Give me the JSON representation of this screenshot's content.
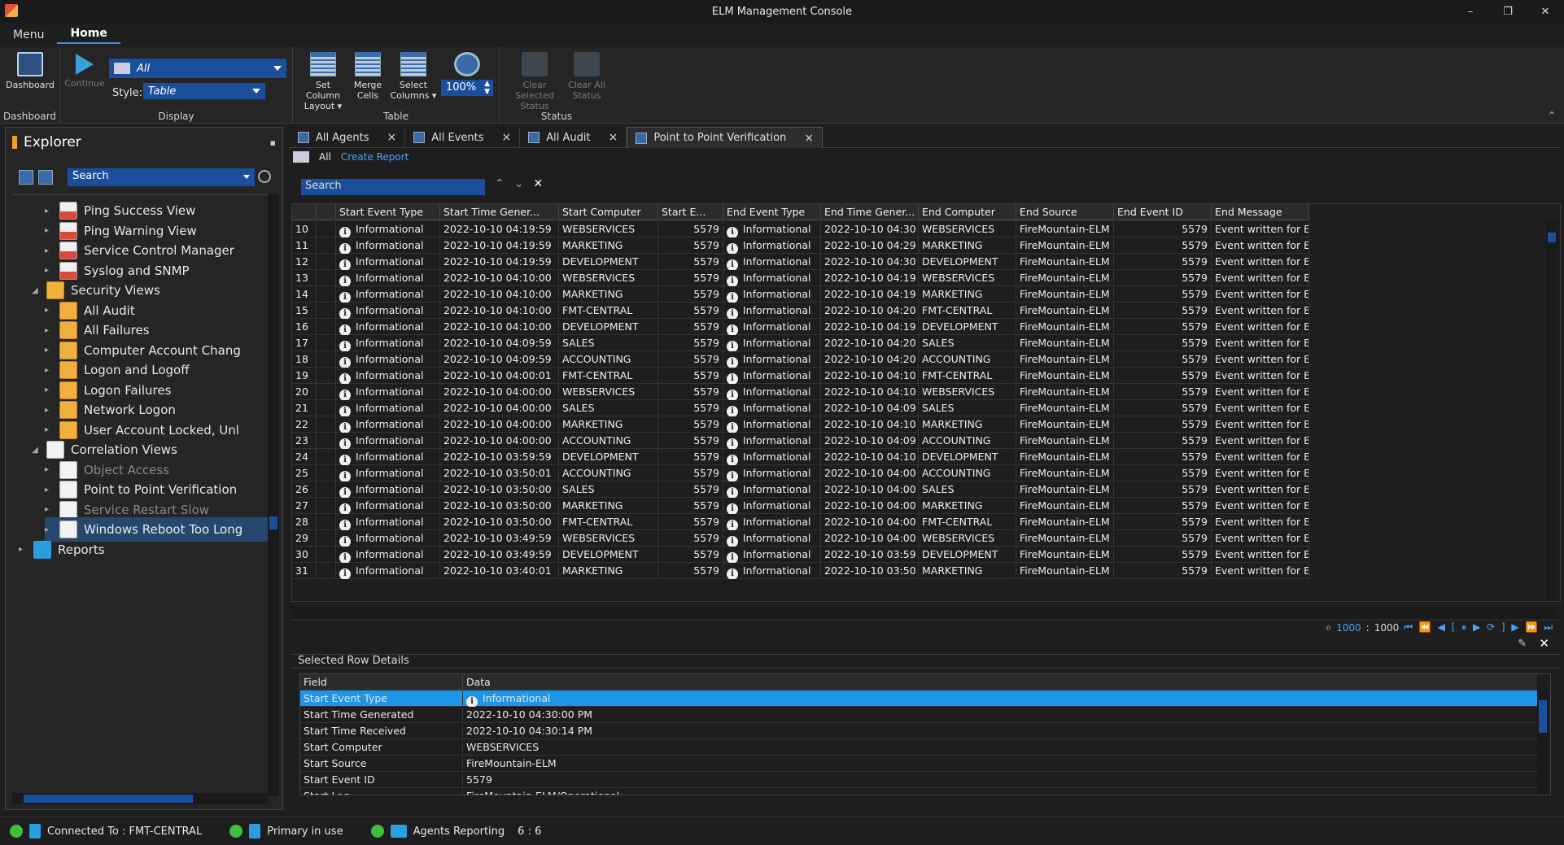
{
  "window": {
    "title": "ELM Management Console",
    "minimize": "–",
    "restore": "❐",
    "close": "✕"
  },
  "menu_tabs": [
    {
      "label": "Menu"
    },
    {
      "label": "Home"
    }
  ],
  "ribbon": {
    "dashboard": {
      "label": "Dashboard",
      "group": "Dashboard"
    },
    "display": {
      "continue": "Continue",
      "view_value": "All",
      "style_label": "Style:",
      "style_value": "Table",
      "group": "Display"
    },
    "table": {
      "set_column_layout": "Set Column\nLayout ▾",
      "merge_cells": "Merge\nCells",
      "select_columns": "Select\nColumns ▾",
      "zoom": "100%",
      "group": "Table"
    },
    "status": {
      "clear_selected": "Clear Selected\nStatus",
      "clear_all": "Clear All\nStatus",
      "group": "Status"
    },
    "collapse": "⌃"
  },
  "explorer": {
    "title": "Explorer",
    "pin": "📌",
    "search_value": "Search",
    "tree": [
      {
        "label": "Ping Success View",
        "icon": "ping-view-icon",
        "level": 2
      },
      {
        "label": "Ping Warning View",
        "icon": "ping-view-icon",
        "level": 2
      },
      {
        "label": "Service Control Manager",
        "icon": "ping-view-icon",
        "level": 2
      },
      {
        "label": "Syslog and SNMP",
        "icon": "ping-view-icon",
        "level": 2
      },
      {
        "label": "Security Views",
        "icon": "key-icon",
        "level": 1,
        "expanded": true
      },
      {
        "label": "All Audit",
        "icon": "key-icon",
        "level": 2
      },
      {
        "label": "All Failures",
        "icon": "key-icon",
        "level": 2
      },
      {
        "label": "Computer Account Chang",
        "icon": "key-icon",
        "level": 2
      },
      {
        "label": "Logon and Logoff",
        "icon": "key-icon",
        "level": 2
      },
      {
        "label": "Logon Failures",
        "icon": "key-icon",
        "level": 2
      },
      {
        "label": "Network Logon",
        "icon": "key-icon",
        "level": 2
      },
      {
        "label": "User Account Locked, Unl",
        "icon": "key-icon",
        "level": 2
      },
      {
        "label": "Correlation Views",
        "icon": "correlation-icon",
        "level": 1,
        "expanded": true
      },
      {
        "label": "Object Access",
        "icon": "correlation-icon",
        "level": 2,
        "disabled": true
      },
      {
        "label": "Point to Point Verification",
        "icon": "correlation-icon",
        "level": 2
      },
      {
        "label": "Service Restart Slow",
        "icon": "correlation-icon",
        "level": 2,
        "disabled": true
      },
      {
        "label": "Windows Reboot Too Long",
        "icon": "correlation-icon",
        "level": 2,
        "selected": true
      },
      {
        "label": "Reports",
        "icon": "folder-icon",
        "level": 0
      }
    ]
  },
  "doc_tabs": [
    {
      "label": "All Agents",
      "close": "×"
    },
    {
      "label": "All  Events",
      "close": "×"
    },
    {
      "label": "All Audit",
      "close": "×"
    },
    {
      "label": "Point to Point Verification",
      "close": "×",
      "active": true
    }
  ],
  "subbar": {
    "filter": "All",
    "create_report": "Create Report"
  },
  "grid_search": {
    "placeholder": "Search",
    "up": "⌃",
    "down": "⌄",
    "close": "✕"
  },
  "grid": {
    "columns": [
      "",
      "",
      "Start Event Type",
      "Start Time Gener...",
      "Start Computer",
      "Start E...",
      "End Event Type",
      "End Time Gener...",
      "End Computer",
      "End Source",
      "End Event ID",
      "End Message"
    ],
    "rows": [
      [
        "10",
        "Informational",
        "2022-10-10 04:19:59",
        "WEBSERVICES",
        "5579",
        "Informational",
        "2022-10-10 04:30",
        "WEBSERVICES",
        "FireMountain-ELM",
        "5579",
        "Event written for E"
      ],
      [
        "11",
        "Informational",
        "2022-10-10 04:19:59",
        "MARKETING",
        "5579",
        "Informational",
        "2022-10-10 04:29",
        "MARKETING",
        "FireMountain-ELM",
        "5579",
        "Event written for E"
      ],
      [
        "12",
        "Informational",
        "2022-10-10 04:19:59",
        "DEVELOPMENT",
        "5579",
        "Informational",
        "2022-10-10 04:30",
        "DEVELOPMENT",
        "FireMountain-ELM",
        "5579",
        "Event written for E"
      ],
      [
        "13",
        "Informational",
        "2022-10-10 04:10:00",
        "WEBSERVICES",
        "5579",
        "Informational",
        "2022-10-10 04:19",
        "WEBSERVICES",
        "FireMountain-ELM",
        "5579",
        "Event written for E"
      ],
      [
        "14",
        "Informational",
        "2022-10-10 04:10:00",
        "MARKETING",
        "5579",
        "Informational",
        "2022-10-10 04:19",
        "MARKETING",
        "FireMountain-ELM",
        "5579",
        "Event written for E"
      ],
      [
        "15",
        "Informational",
        "2022-10-10 04:10:00",
        "FMT-CENTRAL",
        "5579",
        "Informational",
        "2022-10-10 04:20",
        "FMT-CENTRAL",
        "FireMountain-ELM",
        "5579",
        "Event written for E"
      ],
      [
        "16",
        "Informational",
        "2022-10-10 04:10:00",
        "DEVELOPMENT",
        "5579",
        "Informational",
        "2022-10-10 04:19",
        "DEVELOPMENT",
        "FireMountain-ELM",
        "5579",
        "Event written for E"
      ],
      [
        "17",
        "Informational",
        "2022-10-10 04:09:59",
        "SALES",
        "5579",
        "Informational",
        "2022-10-10 04:20",
        "SALES",
        "FireMountain-ELM",
        "5579",
        "Event written for E"
      ],
      [
        "18",
        "Informational",
        "2022-10-10 04:09:59",
        "ACCOUNTING",
        "5579",
        "Informational",
        "2022-10-10 04:20",
        "ACCOUNTING",
        "FireMountain-ELM",
        "5579",
        "Event written for E"
      ],
      [
        "19",
        "Informational",
        "2022-10-10 04:00:01",
        "FMT-CENTRAL",
        "5579",
        "Informational",
        "2022-10-10 04:10",
        "FMT-CENTRAL",
        "FireMountain-ELM",
        "5579",
        "Event written for E"
      ],
      [
        "20",
        "Informational",
        "2022-10-10 04:00:00",
        "WEBSERVICES",
        "5579",
        "Informational",
        "2022-10-10 04:10",
        "WEBSERVICES",
        "FireMountain-ELM",
        "5579",
        "Event written for E"
      ],
      [
        "21",
        "Informational",
        "2022-10-10 04:00:00",
        "SALES",
        "5579",
        "Informational",
        "2022-10-10 04:09",
        "SALES",
        "FireMountain-ELM",
        "5579",
        "Event written for E"
      ],
      [
        "22",
        "Informational",
        "2022-10-10 04:00:00",
        "MARKETING",
        "5579",
        "Informational",
        "2022-10-10 04:10",
        "MARKETING",
        "FireMountain-ELM",
        "5579",
        "Event written for E"
      ],
      [
        "23",
        "Informational",
        "2022-10-10 04:00:00",
        "ACCOUNTING",
        "5579",
        "Informational",
        "2022-10-10 04:09",
        "ACCOUNTING",
        "FireMountain-ELM",
        "5579",
        "Event written for E"
      ],
      [
        "24",
        "Informational",
        "2022-10-10 03:59:59",
        "DEVELOPMENT",
        "5579",
        "Informational",
        "2022-10-10 04:10",
        "DEVELOPMENT",
        "FireMountain-ELM",
        "5579",
        "Event written for E"
      ],
      [
        "25",
        "Informational",
        "2022-10-10 03:50:01",
        "ACCOUNTING",
        "5579",
        "Informational",
        "2022-10-10 04:00",
        "ACCOUNTING",
        "FireMountain-ELM",
        "5579",
        "Event written for E"
      ],
      [
        "26",
        "Informational",
        "2022-10-10 03:50:00",
        "SALES",
        "5579",
        "Informational",
        "2022-10-10 04:00",
        "SALES",
        "FireMountain-ELM",
        "5579",
        "Event written for E"
      ],
      [
        "27",
        "Informational",
        "2022-10-10 03:50:00",
        "MARKETING",
        "5579",
        "Informational",
        "2022-10-10 04:00",
        "MARKETING",
        "FireMountain-ELM",
        "5579",
        "Event written for E"
      ],
      [
        "28",
        "Informational",
        "2022-10-10 03:50:00",
        "FMT-CENTRAL",
        "5579",
        "Informational",
        "2022-10-10 04:00",
        "FMT-CENTRAL",
        "FireMountain-ELM",
        "5579",
        "Event written for E"
      ],
      [
        "29",
        "Informational",
        "2022-10-10 03:49:59",
        "WEBSERVICES",
        "5579",
        "Informational",
        "2022-10-10 04:00",
        "WEBSERVICES",
        "FireMountain-ELM",
        "5579",
        "Event written for E"
      ],
      [
        "30",
        "Informational",
        "2022-10-10 03:49:59",
        "DEVELOPMENT",
        "5579",
        "Informational",
        "2022-10-10 03:59",
        "DEVELOPMENT",
        "FireMountain-ELM",
        "5579",
        "Event written for E"
      ],
      [
        "31",
        "Informational",
        "2022-10-10 03:40:01",
        "MARKETING",
        "5579",
        "Informational",
        "2022-10-10 03:50",
        "MARKETING",
        "FireMountain-ELM",
        "5579",
        "Event written for E"
      ]
    ]
  },
  "pager": {
    "current": "1000",
    "sep": ":",
    "total": "1000",
    "controls": "⏮ ⏪ ◀ [ ⏸ ▶ ⟳ ] ▶ ⏩ ⏭"
  },
  "details": {
    "title": "Selected Row Details",
    "headers": [
      "Field",
      "Data"
    ],
    "rows": [
      [
        "Start Event Type",
        "Informational"
      ],
      [
        "Start Time Generated",
        "2022-10-10 04:30:00 PM"
      ],
      [
        "Start Time Received",
        "2022-10-10 04:30:14 PM"
      ],
      [
        "Start Computer",
        "WEBSERVICES"
      ],
      [
        "Start Source",
        "FireMountain-ELM"
      ],
      [
        "Start Event ID",
        "5579"
      ],
      [
        "Start Log",
        "FireMountain-ELM/Operational"
      ]
    ]
  },
  "statusbar": {
    "connected": "Connected To : FMT-CENTRAL",
    "primary": "Primary in use",
    "agents": "Agents Reporting",
    "agents_count": "6 : 6"
  },
  "colors": {
    "accent": "#1b4f9c",
    "selected": "#1e96e8",
    "status_ok": "#3fbf3f"
  }
}
